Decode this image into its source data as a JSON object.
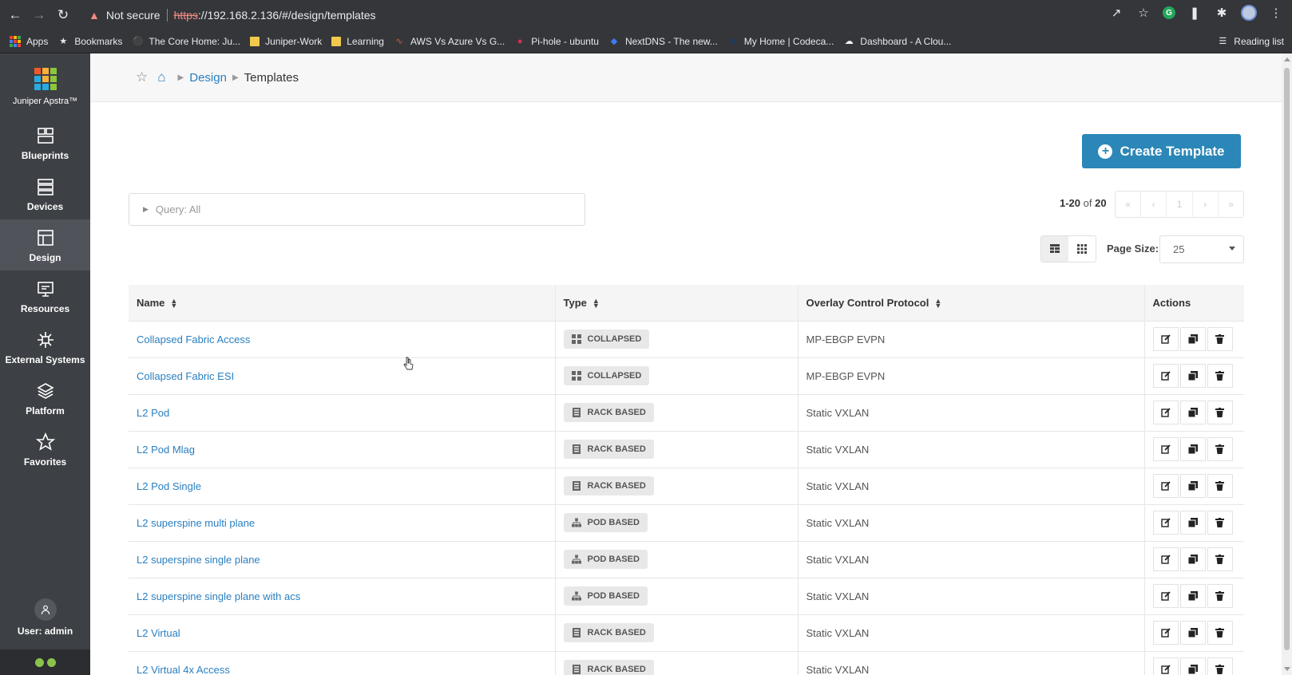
{
  "browser": {
    "not_secure": "Not secure",
    "url_scheme": "https",
    "url_rest": "://192.168.2.136/#/design/templates",
    "bookmarks": [
      {
        "label": "Apps"
      },
      {
        "label": "Bookmarks"
      },
      {
        "label": "The Core Home: Ju..."
      },
      {
        "label": "Juniper-Work"
      },
      {
        "label": "Learning"
      },
      {
        "label": "AWS Vs Azure Vs G..."
      },
      {
        "label": "Pi-hole - ubuntu"
      },
      {
        "label": "NextDNS - The new..."
      },
      {
        "label": "My Home | Codeca..."
      },
      {
        "label": "Dashboard - A Clou..."
      }
    ],
    "reading_list": "Reading list",
    "extension_g": "G"
  },
  "sidebar": {
    "brand": "Juniper Apstra™",
    "items": [
      {
        "label": "Blueprints"
      },
      {
        "label": "Devices"
      },
      {
        "label": "Design"
      },
      {
        "label": "Resources"
      },
      {
        "label": "External Systems"
      },
      {
        "label": "Platform"
      },
      {
        "label": "Favorites"
      }
    ],
    "user": "User: admin",
    "active_item": "Design"
  },
  "breadcrumb": {
    "section": "Design",
    "current": "Templates"
  },
  "toolbar": {
    "create_label": "Create Template",
    "query": "Query: All",
    "page_range": "1-20",
    "of_label": "of",
    "total": "20",
    "current_page": "1",
    "page_size_label": "Page Size:",
    "page_size": "25"
  },
  "table": {
    "columns": [
      "Name",
      "Type",
      "Overlay Control Protocol",
      "Actions"
    ],
    "rows": [
      {
        "name": "Collapsed Fabric Access",
        "type": "COLLAPSED",
        "type_icon": "grid-icon",
        "protocol": "MP-EBGP EVPN"
      },
      {
        "name": "Collapsed Fabric ESI",
        "type": "COLLAPSED",
        "type_icon": "grid-icon",
        "protocol": "MP-EBGP EVPN"
      },
      {
        "name": "L2 Pod",
        "type": "RACK BASED",
        "type_icon": "rack-icon",
        "protocol": "Static VXLAN"
      },
      {
        "name": "L2 Pod Mlag",
        "type": "RACK BASED",
        "type_icon": "rack-icon",
        "protocol": "Static VXLAN"
      },
      {
        "name": "L2 Pod Single",
        "type": "RACK BASED",
        "type_icon": "rack-icon",
        "protocol": "Static VXLAN"
      },
      {
        "name": "L2 superspine multi plane",
        "type": "POD BASED",
        "type_icon": "hierarchy-icon",
        "protocol": "Static VXLAN"
      },
      {
        "name": "L2 superspine single plane",
        "type": "POD BASED",
        "type_icon": "hierarchy-icon",
        "protocol": "Static VXLAN"
      },
      {
        "name": "L2 superspine single plane with acs",
        "type": "POD BASED",
        "type_icon": "hierarchy-icon",
        "protocol": "Static VXLAN"
      },
      {
        "name": "L2 Virtual",
        "type": "RACK BASED",
        "type_icon": "rack-icon",
        "protocol": "Static VXLAN"
      },
      {
        "name": "L2 Virtual 4x Access",
        "type": "RACK BASED",
        "type_icon": "rack-icon",
        "protocol": "Static VXLAN"
      }
    ]
  },
  "colors": {
    "accent": "#2b87b7",
    "link": "#2a7fc0",
    "sidebar": "#3d4044",
    "status_ok": "#8bc34a"
  }
}
